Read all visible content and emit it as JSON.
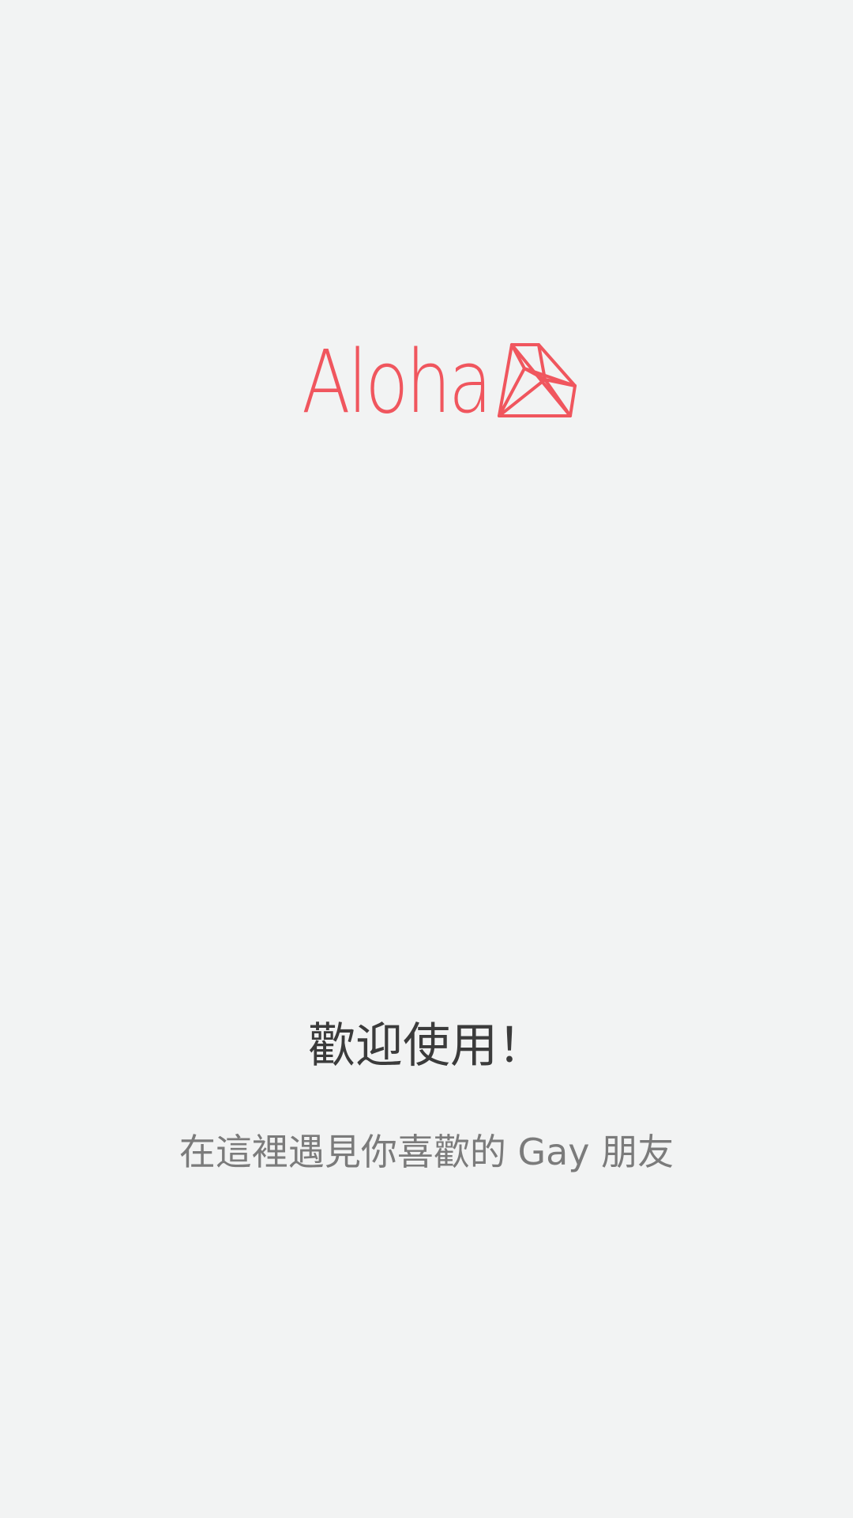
{
  "app": {
    "logo_text": "Aloha",
    "logo_icon": "diamond-icon",
    "accent_color": "#f0565e",
    "background_color": "#f2f3f3"
  },
  "welcome": {
    "title": "歡迎使用！",
    "subtitle": "在這裡遇見你喜歡的 Gay 朋友"
  }
}
